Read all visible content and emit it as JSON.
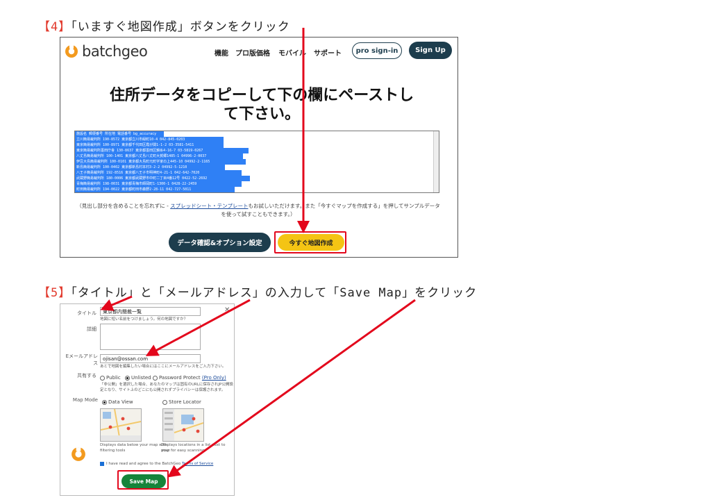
{
  "step4": {
    "title_num": "【4】",
    "title_text": "「いますぐ地図作成」ボタンをクリック",
    "app": {
      "logo": "batchgeo",
      "nav": [
        "機能",
        "プロ版価格",
        "モバイル",
        "サポート"
      ],
      "pro_signin": "pro sign-in",
      "signup": "Sign Up",
      "headline_1": "住所データをコピーして下の欄にペーストし",
      "headline_2": "て下さい。",
      "data_rows": [
        "施設名 郵便番号 所在地 電話番号 bg_accuracy",
        "立川簡易裁判所 190-8572 東京都立川市緑町10-4 042-845-0203",
        "東京簡易裁判所 100-8971 東京都千代田区霞が関1-1-2 03-3581-5411",
        "東京簡易裁判所墨田庁舎 130-8637 東京都墨田区錦糸4-16-7 03-5819-0267",
        "八丈島簡易裁判所 100-1401 東京都八丈島八丈町大賀郷1485-1 04996-2-0037",
        "伊豆大島簡易裁判所 100-0101 東京都大島町元町字家の上445-10 04992-2-1165",
        "新島簡易裁判所 100-0402 東京都新島村本村3-2-2 04992-5-1210",
        "八王子簡易裁判所 192-8516 東京都八王子市明神町4-21-1 042-642-7020",
        "武蔵野簡易裁判所 180-0006 東京都武蔵野市中町二丁目4番12号 0422-52-2692",
        "青梅簡易裁判所 198-0031 東京都青梅市師岡町1-1300-1 0428-22-2459",
        "町田簡易裁判所 194-0022 東京都町田市森野2-28-11 042-727-5011"
      ],
      "note_1": "（見出し部分を含めることを忘れずに - ",
      "note_link": "スプレッドシート・テンプレート",
      "note_2": "もお試しいただけます。また「今すぐマップを作成する」を押してサンプルデータ",
      "note_3": "を使って試すこともできます。）",
      "btn_options": "データ確認&オプション設定",
      "btn_create": "今すぐ地図作成"
    }
  },
  "step5": {
    "title_num": "【5】",
    "title_text": "「タイトル」と「メールアドレス」の入力して「Save Map」をクリック",
    "form": {
      "title_label": "タイトル",
      "title_value": "東京都内簡裁一覧",
      "title_hint": "地図に短い名前をつけましょう。何の地図ですか？",
      "detail_label": "詳細",
      "email_label": "Eメールアドレス",
      "email_value": "ojisan@ossan.com",
      "email_hint": "あとで地図を編集したい場合にはここにメールアドレスをご入力下さい。",
      "share_label": "共有する",
      "share_public": "Public",
      "share_unlisted": "Unlisted",
      "share_password": "Password Protect",
      "share_pro": "(Pro Only)",
      "share_hint_1": "「非公開」を選択した場合、あなたのマップは固有のURLに保存されJP公開設",
      "share_hint_2": "定となり、サイト上のどこにも公開されずプライバシーは保護されます。",
      "mode_label": "Map Mode",
      "mode_data": "Data View",
      "mode_store": "Store Locator",
      "mode_data_desc_1": "Displays data below your map with",
      "mode_data_desc_2": "filtering tools",
      "mode_store_desc_1": "Displays locations in a list next to your",
      "mode_store_desc_2": "map for easy scanning",
      "terms_text": "I have read and agree to the BatchGeo ",
      "terms_link": "Terms of Service",
      "save_button": "Save Map"
    }
  },
  "colors": {
    "accent_red": "#e3071c",
    "orange": "#f39a1e",
    "dark": "#1d3d4d",
    "yellow": "#f4c414",
    "green": "#15843a"
  }
}
